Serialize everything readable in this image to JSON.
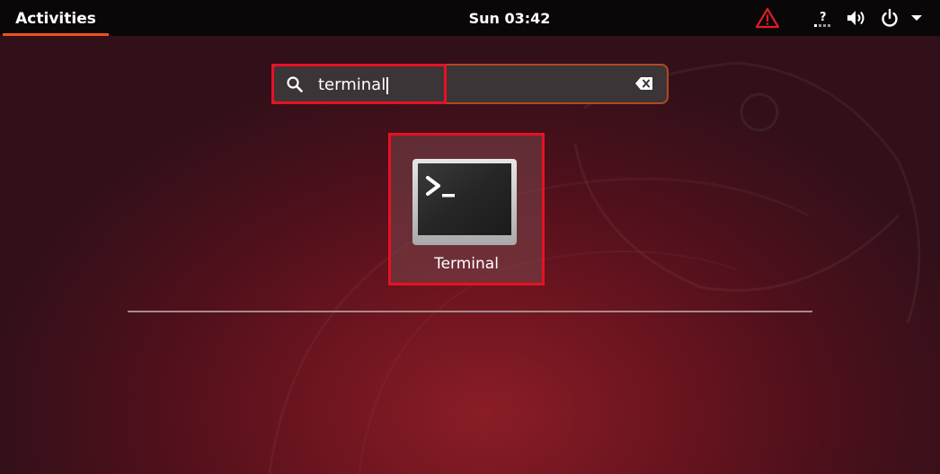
{
  "topbar": {
    "activities_label": "Activities",
    "clock": "Sun 03:42",
    "tray_icons": [
      "warning-icon",
      "network-unknown-icon",
      "volume-icon",
      "power-icon",
      "chevron-down-icon"
    ]
  },
  "search": {
    "value": "terminal",
    "clear_icon": "backspace-clear-icon"
  },
  "results": [
    {
      "label": "Terminal",
      "icon": "terminal-app-icon"
    }
  ],
  "colors": {
    "accent": "#e95420",
    "highlight": "#e81123",
    "warning": "#e01b24"
  }
}
